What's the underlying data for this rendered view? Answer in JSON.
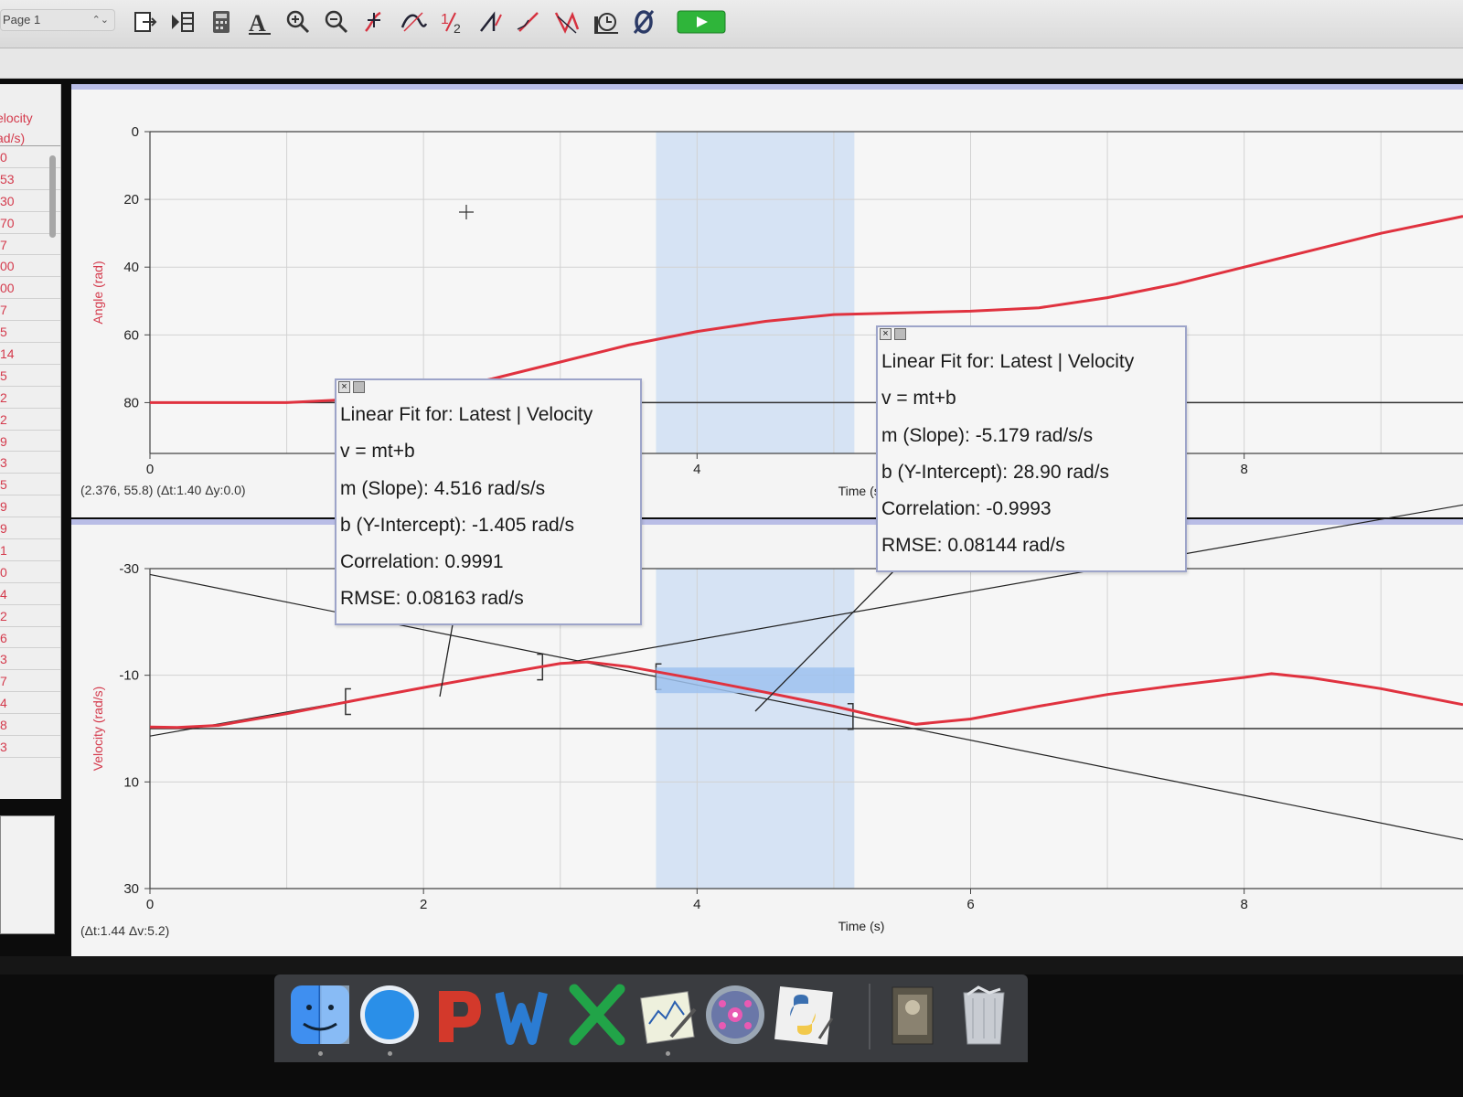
{
  "toolbar": {
    "page_select": "Page 1",
    "buttons": [
      "file-export-icon",
      "data-browser-icon",
      "calculator-icon",
      "autoscale-icon",
      "zoom-in-icon",
      "zoom-out-icon",
      "examine-icon",
      "tangent-icon",
      "integral-icon",
      "statistics-icon",
      "linear-fit-icon",
      "curve-fit-icon",
      "replay-icon",
      "zero-icon",
      "collect-icon"
    ],
    "collect_color": "#2fb53a"
  },
  "data_table": {
    "header_line1": "elocity",
    "header_line2": "ad/s)",
    "cells": [
      "0",
      "53",
      "30",
      "70",
      "7",
      "00",
      "00",
      "7",
      "5",
      "14",
      "5",
      "2",
      "2",
      "9",
      "3",
      "5",
      "9",
      "9",
      "1",
      "0",
      "4",
      "2",
      "6",
      "3",
      "7",
      "4",
      "8",
      "3"
    ]
  },
  "top_graph": {
    "ylabel": "Angle (rad)",
    "xlabel": "Time (s)",
    "y_ticks": [
      "80",
      "60",
      "40",
      "20",
      "0"
    ],
    "x_ticks": [
      "0",
      "4",
      "8"
    ],
    "readout": "(2.376, 55.8) (Δt:1.40 Δy:0.0)"
  },
  "bottom_graph": {
    "ylabel": "Velocity (rad/s)",
    "xlabel": "Time (s)",
    "y_ticks": [
      "30",
      "10",
      "-10",
      "-30"
    ],
    "x_ticks": [
      "0",
      "2",
      "4",
      "6",
      "8"
    ],
    "readout": "(Δt:1.44 Δv:5.2)"
  },
  "fit_left": {
    "title": "Linear Fit for: Latest | Velocity",
    "equation": "v = mt+b",
    "slope": "m (Slope): 4.516 rad/s/s",
    "intercept": "b (Y-Intercept): -1.405 rad/s",
    "correlation": "Correlation: 0.9991",
    "rmse": "RMSE: 0.08163 rad/s"
  },
  "fit_right": {
    "title": "Linear Fit for: Latest | Velocity",
    "equation": "v = mt+b",
    "slope": "m (Slope): -5.179 rad/s/s",
    "intercept": "b (Y-Intercept): 28.90 rad/s",
    "correlation": "Correlation: -0.9993",
    "rmse": "RMSE: 0.08144 rad/s"
  },
  "colors": {
    "data_line": "#e0323f",
    "fit_line": "#222222",
    "selection": "#c9dcf3",
    "selection_strong": "#9fc2ee",
    "panel_border": "#b9bde6"
  },
  "chart_data": [
    {
      "type": "line",
      "title": "",
      "xlabel": "Time (s)",
      "ylabel": "Angle (rad)",
      "xlim": [
        0,
        9.6
      ],
      "ylim": [
        -15,
        80
      ],
      "x_ticks": [
        0,
        4,
        8
      ],
      "y_ticks": [
        0,
        20,
        40,
        60,
        80
      ],
      "grid": true,
      "series": [
        {
          "x": [
            0,
            1,
            1.5,
            2.0,
            2.5,
            3.0,
            3.5,
            4.0,
            4.5,
            5.0,
            5.5,
            6.0,
            6.5,
            7.0,
            7.5,
            8.0,
            8.5,
            9.0,
            9.6
          ],
          "y": [
            0,
            0,
            1,
            3,
            7,
            12,
            17,
            21,
            24,
            26,
            26.5,
            27,
            28,
            31,
            35,
            40,
            45,
            50,
            55
          ]
        }
      ],
      "selection_x": [
        3.7,
        5.15
      ]
    },
    {
      "type": "line",
      "title": "",
      "xlabel": "Time (s)",
      "ylabel": "Velocity (rad/s)",
      "xlim": [
        0,
        9.6
      ],
      "ylim": [
        -30,
        30
      ],
      "x_ticks": [
        0,
        2,
        4,
        6,
        8
      ],
      "y_ticks": [
        -30,
        -10,
        10,
        30
      ],
      "grid": true,
      "series": [
        {
          "x": [
            0,
            0.2,
            0.5,
            1.0,
            1.5,
            2.0,
            2.5,
            3.0,
            3.2,
            3.5,
            4.0,
            4.5,
            5.0,
            5.3,
            5.6,
            6.0,
            6.5,
            7.0,
            7.5,
            8.0,
            8.2,
            8.5,
            9.0,
            9.6
          ],
          "y": [
            0.3,
            0.2,
            0.6,
            2.8,
            5.3,
            7.7,
            10.0,
            12.2,
            12.5,
            11.6,
            9.3,
            6.8,
            4.2,
            2.4,
            0.8,
            1.8,
            4.2,
            6.4,
            8.1,
            9.6,
            10.3,
            9.5,
            7.5,
            4.5
          ]
        }
      ],
      "fits": [
        {
          "m": 4.516,
          "b": -1.405,
          "range": [
            1.43,
            2.87
          ]
        },
        {
          "m": -5.179,
          "b": 28.9,
          "range": [
            3.7,
            5.14
          ]
        }
      ],
      "selection_x": [
        3.7,
        5.15
      ]
    }
  ]
}
